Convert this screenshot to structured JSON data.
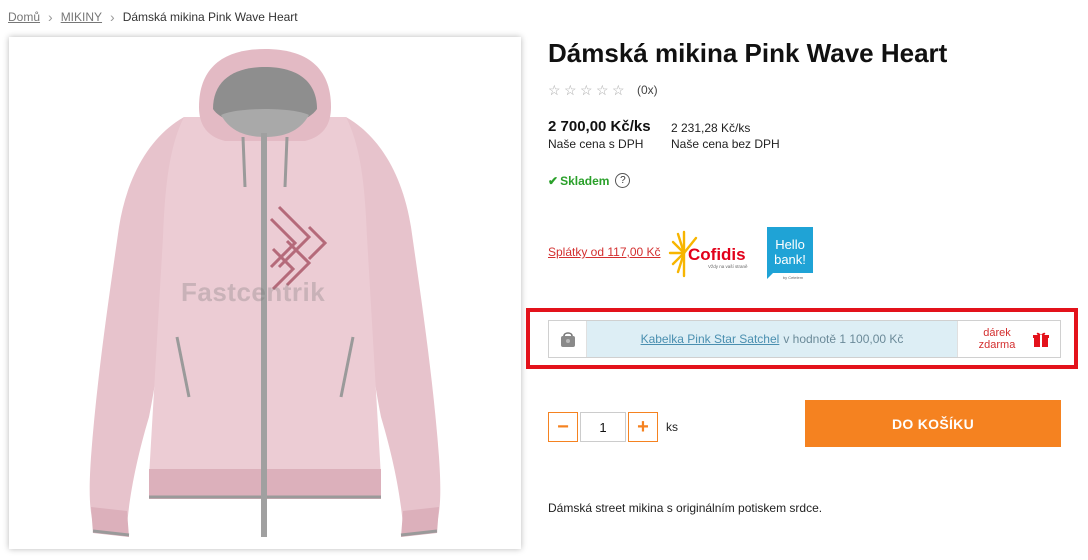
{
  "breadcrumb": {
    "home": "Domů",
    "category": "MIKINY",
    "current": "Dámská mikina Pink Wave Heart"
  },
  "product": {
    "image": {
      "watermark": "Fastcentrik",
      "alt_icon": "hoodie-image"
    },
    "title": "Dámská mikina Pink Wave Heart",
    "rating": {
      "stars_filled": 0,
      "stars_total": 5,
      "count": "(0x)"
    },
    "price": {
      "with_vat": "2 700,00 Kč/ks",
      "with_vat_label": "Naše cena s DPH",
      "without_vat": "2 231,28 Kč/ks",
      "without_vat_label": "Naše cena bez DPH"
    },
    "stock": {
      "label": "Skladem",
      "help": "?"
    },
    "installments": {
      "label": "Splátky od 117,00 Kč",
      "cofidis_brand": "Cofidis",
      "cofidis_tagline": "Vždy na vaší straně",
      "hellobank_line1": "Hello",
      "hellobank_line2": "bank!",
      "hellobank_sub": "by Cetelem"
    },
    "gift": {
      "link_text": "Kabelka Pink Star Satchel",
      "value_text": "v hodnotě 1 100,00 Kč",
      "free_label": "dárek zdarma"
    },
    "quantity": {
      "value": "1",
      "unit": "ks",
      "minus": "−",
      "plus": "+"
    },
    "add_to_cart": "DO KOŠÍKU",
    "description": "Dámská street mikina s originálním potiskem srdce."
  },
  "colors": {
    "accent_orange": "#f58220",
    "highlight_red": "#e3121b",
    "stock_green": "#2aa02a",
    "link_red": "#d32f2f",
    "gift_bg": "#ddeef5"
  }
}
